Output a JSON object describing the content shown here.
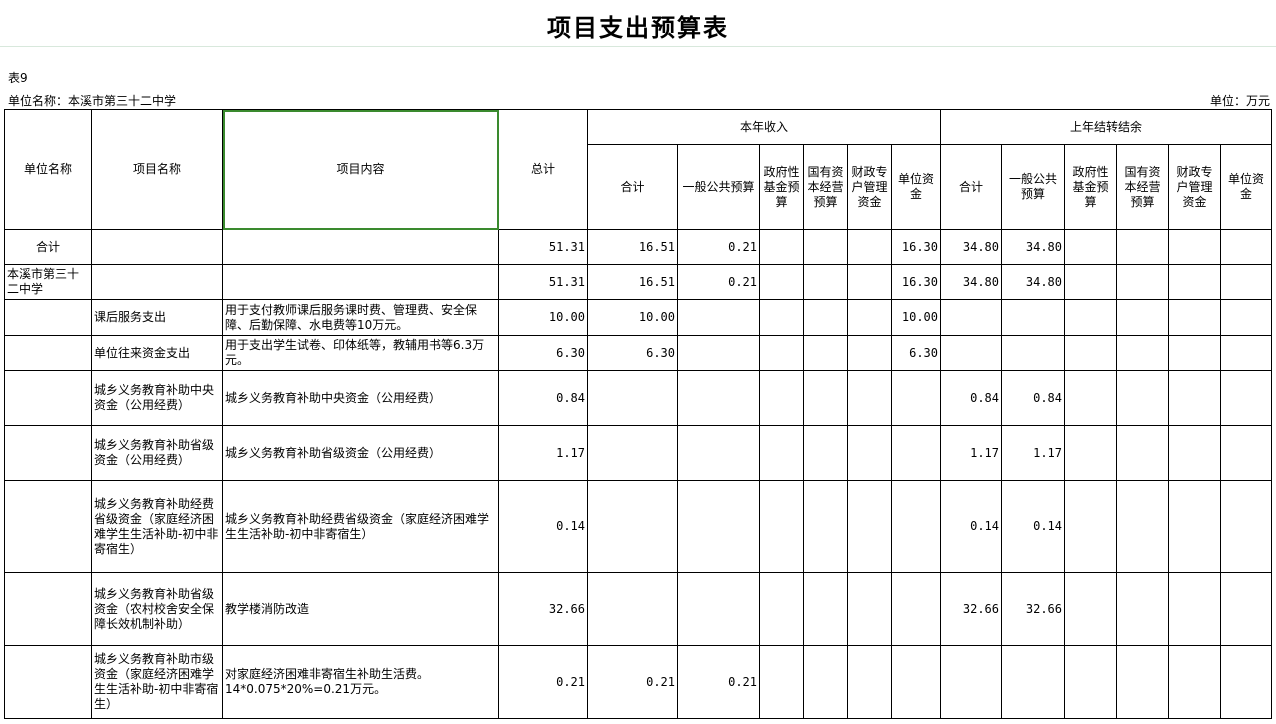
{
  "title": "项目支出预算表",
  "table_no": "表9",
  "unit_name": "单位名称：本溪市第三十二中学",
  "unit": "单位：万元",
  "headers": {
    "unit_name": "单位名称",
    "project_name": "项目名称",
    "project_content": "项目内容",
    "total": "总计",
    "current_income": "本年收入",
    "carryover": "上年结转结余",
    "sub": [
      "合计",
      "一般公共预算",
      "政府性基金预算",
      "国有资本经营预算",
      "财政专户管理资金",
      "单位资金"
    ],
    "sub2": [
      "合计",
      "一般公共预算",
      "政府性基金预算",
      "国有资本经营预算",
      "财政专户管理资金",
      "单位资金"
    ]
  },
  "rows": [
    {
      "unit": "合计",
      "name": "",
      "content": "",
      "total": "51.31",
      "c1": "16.51",
      "c2": "0.21",
      "c3": "",
      "c4": "",
      "c5": "",
      "c6": "16.30",
      "p1": "34.80",
      "p2": "34.80",
      "p3": "",
      "p4": "",
      "p5": "",
      "p6": ""
    },
    {
      "unit": "本溪市第三十二中学",
      "name": "",
      "content": "",
      "total": "51.31",
      "c1": "16.51",
      "c2": "0.21",
      "c3": "",
      "c4": "",
      "c5": "",
      "c6": "16.30",
      "p1": "34.80",
      "p2": "34.80",
      "p3": "",
      "p4": "",
      "p5": "",
      "p6": ""
    },
    {
      "unit": "",
      "name": "课后服务支出",
      "content": "用于支付教师课后服务课时费、管理费、安全保障、后勤保障、水电费等10万元。",
      "total": "10.00",
      "c1": "10.00",
      "c2": "",
      "c3": "",
      "c4": "",
      "c5": "",
      "c6": "10.00",
      "p1": "",
      "p2": "",
      "p3": "",
      "p4": "",
      "p5": "",
      "p6": ""
    },
    {
      "unit": "",
      "name": "单位往来资金支出",
      "content": "用于支出学生试卷、印体纸等，教辅用书等6.3万元。",
      "total": "6.30",
      "c1": "6.30",
      "c2": "",
      "c3": "",
      "c4": "",
      "c5": "",
      "c6": "6.30",
      "p1": "",
      "p2": "",
      "p3": "",
      "p4": "",
      "p5": "",
      "p6": ""
    },
    {
      "unit": "",
      "name": "城乡义务教育补助中央资金（公用经费）",
      "content": "城乡义务教育补助中央资金（公用经费）",
      "total": "0.84",
      "c1": "",
      "c2": "",
      "c3": "",
      "c4": "",
      "c5": "",
      "c6": "",
      "p1": "0.84",
      "p2": "0.84",
      "p3": "",
      "p4": "",
      "p5": "",
      "p6": ""
    },
    {
      "unit": "",
      "name": "城乡义务教育补助省级资金（公用经费）",
      "content": "城乡义务教育补助省级资金（公用经费）",
      "total": "1.17",
      "c1": "",
      "c2": "",
      "c3": "",
      "c4": "",
      "c5": "",
      "c6": "",
      "p1": "1.17",
      "p2": "1.17",
      "p3": "",
      "p4": "",
      "p5": "",
      "p6": ""
    },
    {
      "unit": "",
      "name": "城乡义务教育补助经费省级资金（家庭经济困难学生生活补助-初中非寄宿生）",
      "content": "城乡义务教育补助经费省级资金（家庭经济困难学生生活补助-初中非寄宿生）",
      "total": "0.14",
      "c1": "",
      "c2": "",
      "c3": "",
      "c4": "",
      "c5": "",
      "c6": "",
      "p1": "0.14",
      "p2": "0.14",
      "p3": "",
      "p4": "",
      "p5": "",
      "p6": ""
    },
    {
      "unit": "",
      "name": "城乡义务教育补助省级资金（农村校舍安全保障长效机制补助）",
      "content": "教学楼消防改造",
      "total": "32.66",
      "c1": "",
      "c2": "",
      "c3": "",
      "c4": "",
      "c5": "",
      "c6": "",
      "p1": "32.66",
      "p2": "32.66",
      "p3": "",
      "p4": "",
      "p5": "",
      "p6": ""
    },
    {
      "unit": "",
      "name": "城乡义务教育补助市级资金（家庭经济困难学生生活补助-初中非寄宿生）",
      "content": "对家庭经济困难非寄宿生补助生活费。14*0.075*20%=0.21万元。",
      "total": "0.21",
      "c1": "0.21",
      "c2": "0.21",
      "c3": "",
      "c4": "",
      "c5": "",
      "c6": "",
      "p1": "",
      "p2": "",
      "p3": "",
      "p4": "",
      "p5": "",
      "p6": ""
    }
  ]
}
